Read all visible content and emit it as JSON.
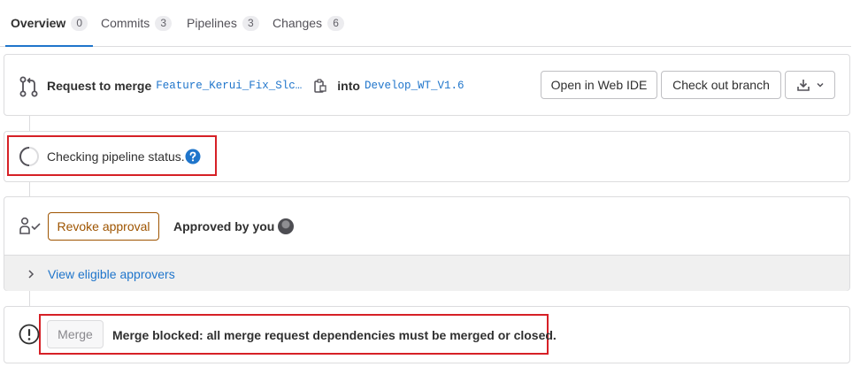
{
  "tabs": [
    {
      "label": "Overview",
      "count": "0",
      "active": true
    },
    {
      "label": "Commits",
      "count": "3",
      "active": false
    },
    {
      "label": "Pipelines",
      "count": "3",
      "active": false
    },
    {
      "label": "Changes",
      "count": "6",
      "active": false
    }
  ],
  "merge_request": {
    "prefix": "Request to merge",
    "source_branch": "Feature_Kerui_Fix_Slc…",
    "into_label": "into",
    "target_branch": "Develop_WT_V1.6",
    "open_ide_label": "Open in Web IDE",
    "checkout_label": "Check out branch"
  },
  "pipeline": {
    "status_text": "Checking pipeline status."
  },
  "approval": {
    "revoke_label": "Revoke approval",
    "approved_text": "Approved by you",
    "eligible_label": "View eligible approvers"
  },
  "merge": {
    "button_label": "Merge",
    "blocked_text": "Merge blocked: all merge request dependencies must be merged or closed."
  },
  "colors": {
    "link": "#1f75cb",
    "highlight": "#d62026",
    "revoke": "#9e5400"
  }
}
